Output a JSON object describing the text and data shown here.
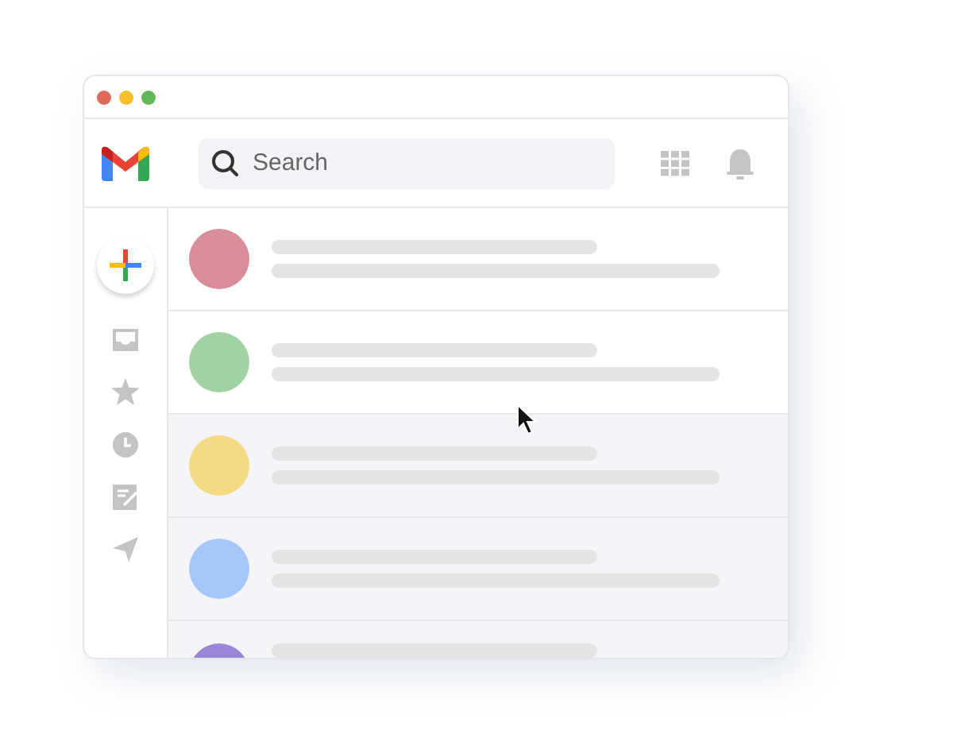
{
  "window": {
    "controls": [
      {
        "color": "#e0685a"
      },
      {
        "color": "#f5c02c"
      },
      {
        "color": "#62b75b"
      }
    ]
  },
  "search": {
    "placeholder": "Search"
  },
  "messages": [
    {
      "color": "#d98d96",
      "read": false
    },
    {
      "color": "#9fd3a3",
      "read": false
    },
    {
      "color": "#f6d983",
      "read": true
    },
    {
      "color": "#a5c8fb",
      "read": true
    },
    {
      "color": "#9b85d8",
      "read": true
    }
  ]
}
